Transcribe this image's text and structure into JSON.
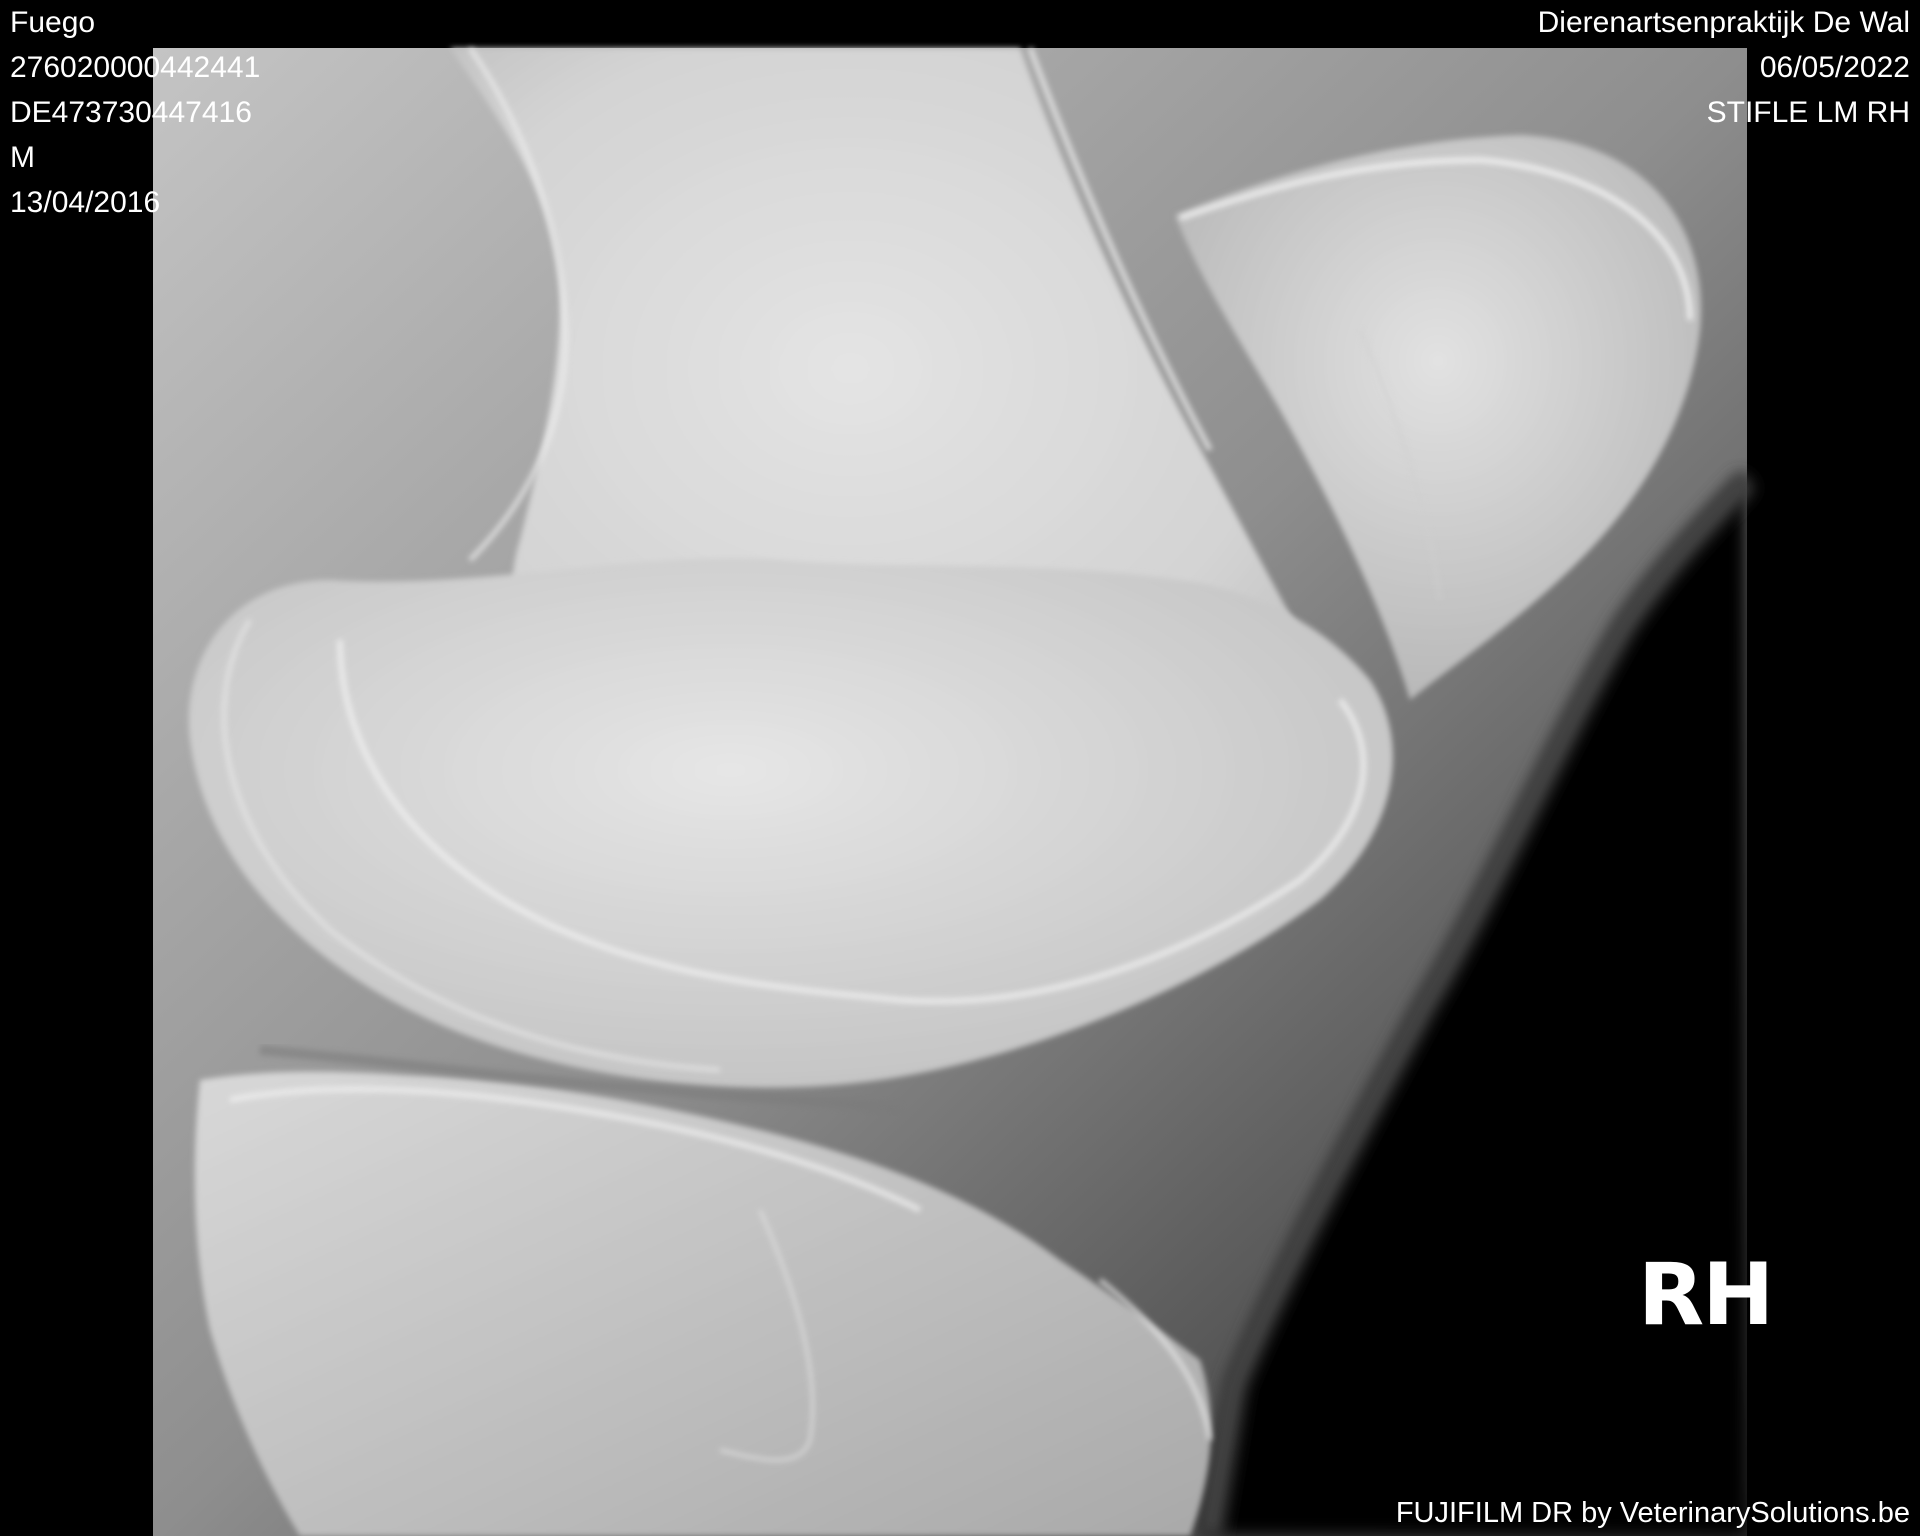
{
  "patient": {
    "name": "Fuego",
    "chip_id": "276020000442441",
    "passport_id": "DE473730447416",
    "sex": "M",
    "birth_date": "13/04/2016"
  },
  "study": {
    "practice": "Dierenartsenpraktijk De Wal",
    "date": "06/05/2022",
    "view": "STIFLE LM RH"
  },
  "image": {
    "subject": "radiograph-stifle-lateromedial",
    "side_marker": "RH",
    "footer": "FUJIFILM DR by VeterinarySolutions.be"
  },
  "colors": {
    "background": "#000000",
    "overlay_text": "#ffffff"
  }
}
